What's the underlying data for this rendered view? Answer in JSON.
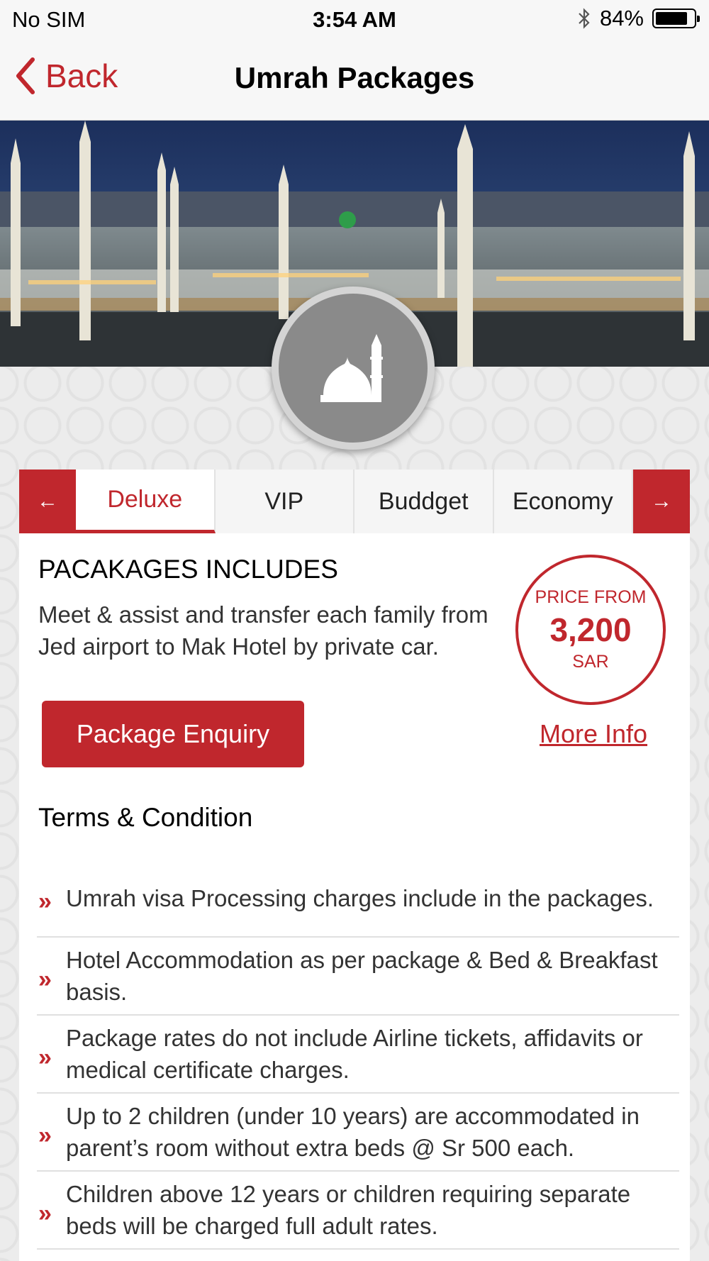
{
  "status_bar": {
    "carrier": "No SIM",
    "time": "3:54 AM",
    "battery": "84%",
    "battery_level": 0.84
  },
  "nav": {
    "back_label": "Back",
    "title": "Umrah Packages"
  },
  "tabs": {
    "prev_icon": "←",
    "next_icon": "→",
    "items": [
      "Deluxe",
      "VIP",
      "Buddget",
      "Economy"
    ],
    "active": "Deluxe"
  },
  "package": {
    "includes_title": "PACAKAGES INCLUDES",
    "description": "Meet & assist and transfer each family from Jed airport to Mak Hotel by private car.",
    "enquiry_label": "Package Enquiry",
    "price_label": "PRICE FROM",
    "price_value": "3,200",
    "price_currency": "SAR",
    "more_info_label": "More Info"
  },
  "terms": {
    "title": "Terms & Condition",
    "bullet": "»",
    "items": [
      "Umrah visa Processing charges include in the packages.",
      "Hotel Accommodation as per package & Bed & Breakfast basis.",
      "Package rates do not include Airline tickets, affidavits or medical certificate charges.",
      "Up to 2 children (under 10 years) are accommodated in parent’s room without extra beds @ Sr 500 each.",
      "Children above 12 years or children requiring separate beds will be charged full adult rates."
    ]
  },
  "colors": {
    "accent": "#c0272d",
    "bar_bg": "#f7f7f7",
    "emblem": "#8a8a8a"
  },
  "icons": {
    "back": "chevron-left-icon",
    "bluetooth": "bluetooth-icon",
    "battery": "battery-icon",
    "emblem": "mosque-icon"
  }
}
